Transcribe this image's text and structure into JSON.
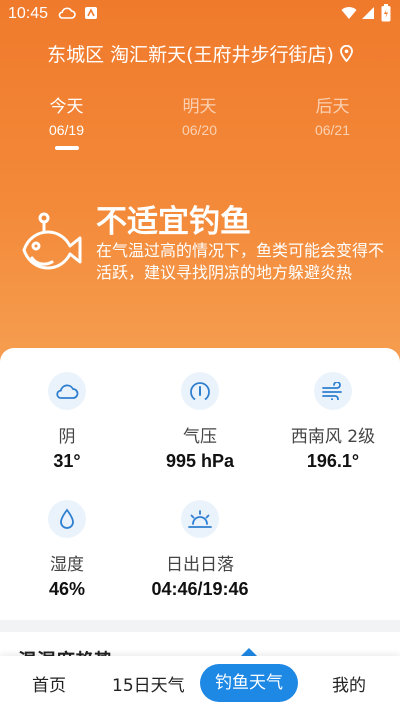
{
  "status_bar": {
    "time": "10:45"
  },
  "location": {
    "text": "东城区 淘汇新天(王府井步行街店)"
  },
  "days": [
    {
      "name": "今天",
      "date": "06/19",
      "active": true
    },
    {
      "name": "明天",
      "date": "06/20",
      "active": false
    },
    {
      "name": "后天",
      "date": "06/21",
      "active": false
    }
  ],
  "fishing": {
    "verdict": "不适宜钓鱼",
    "description": "在气温过高的情况下，鱼类可能会变得不活跃，建议寻找阴凉的地方躲避炎热"
  },
  "stats": [
    {
      "icon": "cloud-icon",
      "label": "阴",
      "value": "31°"
    },
    {
      "icon": "pressure-gauge-icon",
      "label": "气压",
      "value": "995 hPa"
    },
    {
      "icon": "wind-icon",
      "label": "西南风 2级",
      "value": "196.1°"
    },
    {
      "icon": "humidity-drop-icon",
      "label": "湿度",
      "value": "46%"
    },
    {
      "icon": "sunrise-icon",
      "label": "日出日落",
      "value": "04:46/19:46"
    }
  ],
  "section_peek": "温湿度趋势",
  "bottom_nav": {
    "home": "首页",
    "forecast15": "15日天气",
    "fishing": "钓鱼天气",
    "mine": "我的"
  },
  "colors": {
    "hero_top": "#f07a2c",
    "hero_bottom": "#f6a052",
    "accent": "#1e88e5",
    "icon_bg": "#eaf3fb",
    "icon_stroke": "#2f7fd1"
  }
}
